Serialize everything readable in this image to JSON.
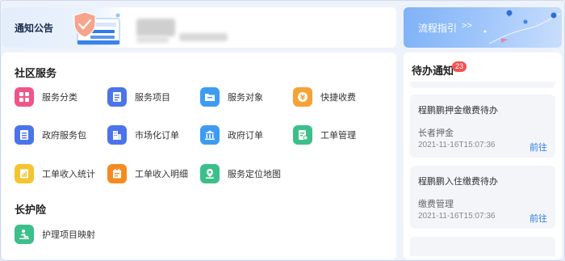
{
  "notice": {
    "title": "通知公告"
  },
  "guide": {
    "label": "流程指引",
    "arrows": ">>"
  },
  "services": {
    "section_community": "社区服务",
    "section_care": "长护险",
    "items": [
      {
        "label": "服务分类",
        "icon": "category-icon",
        "color": "#f0558a"
      },
      {
        "label": "服务项目",
        "icon": "list-icon",
        "color": "#4b74ea"
      },
      {
        "label": "服务对象",
        "icon": "folder-icon",
        "color": "#3e9bf2"
      },
      {
        "label": "快捷收费",
        "icon": "yuan-icon",
        "color": "#f5a236"
      },
      {
        "label": "政府服务包",
        "icon": "package-icon",
        "color": "#4b74ea"
      },
      {
        "label": "市场化订单",
        "icon": "building-icon",
        "color": "#4b74ea"
      },
      {
        "label": "政府订单",
        "icon": "government-icon",
        "color": "#3e9bf2"
      },
      {
        "label": "工单管理",
        "icon": "workorder-icon",
        "color": "#3cbf8a"
      },
      {
        "label": "工单收入统计",
        "icon": "chart-icon",
        "color": "#f4c430"
      },
      {
        "label": "工单收入明细",
        "icon": "calendar-icon",
        "color": "#f58b1f"
      },
      {
        "label": "服务定位地图",
        "icon": "map-pin-icon",
        "color": "#3cbf8a"
      }
    ],
    "care_items": [
      {
        "label": "护理项目映射",
        "icon": "care-icon",
        "color": "#3cbf8a"
      }
    ]
  },
  "todo": {
    "title": "待办通知",
    "badge": "23",
    "cards": [
      {
        "title": "程鹏鹏押金缴费待办",
        "type": "长者押金",
        "time": "2021-11-16T15:07:36",
        "link": "前往"
      },
      {
        "title": "程鹏鹏入住缴费待办",
        "type": "缴费管理",
        "time": "2021-11-16T15:07:36",
        "link": "前往"
      }
    ]
  }
}
